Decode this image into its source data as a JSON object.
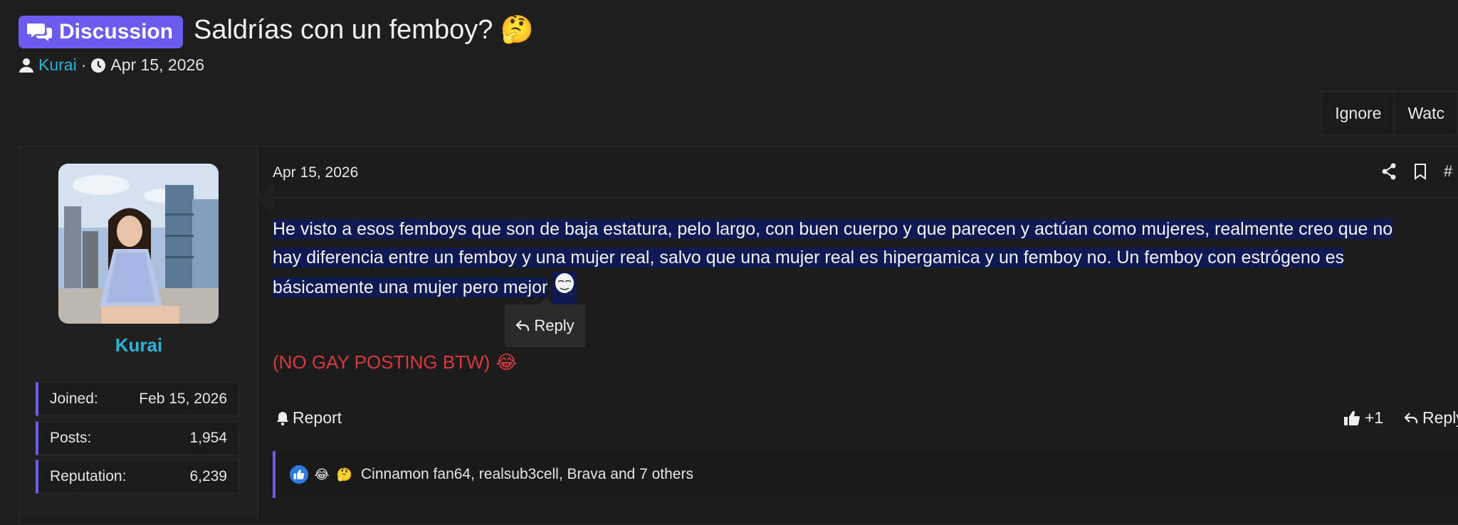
{
  "thread": {
    "prefix": "Discussion",
    "title": "Saldrías con un femboy?",
    "title_emoji": "🤔",
    "author": "Kurai",
    "byline_sep": "·",
    "date": "Apr 15, 2026"
  },
  "thread_actions": [
    "Ignore",
    "Watc"
  ],
  "user": {
    "name": "Kurai",
    "stats": [
      {
        "label": "Joined:",
        "value": "Feb 15, 2026"
      },
      {
        "label": "Posts:",
        "value": "1,954"
      },
      {
        "label": "Reputation:",
        "value": "6,239"
      }
    ]
  },
  "post": {
    "date": "Apr 15, 2026",
    "hash": "#",
    "body_lines": [
      "He visto a esos femboys que son de baja estatura, pelo largo, con buen cuerpo y que parecen y actúan como mujeres, realmente creo que no",
      "hay diferencia entre un femboy y una mujer real, salvo que una mujer real es hipergamica y un femboy no. Un femboy con estrógeno es",
      "básicamente una mujer pero mejor"
    ],
    "tooltip_reply": "Reply",
    "red_note": "(NO GAY POSTING BTW)",
    "red_emoji": "😂",
    "report_label": "Report",
    "like_label": "+1",
    "reply_label": "Reply",
    "reactions_text": "Cinnamon fan64, realsub3cell, Brava and 7 others",
    "reaction_icons": [
      "👍",
      "😂",
      "🤔"
    ]
  },
  "colors": {
    "accent": "#6b5cf0",
    "username": "#2bb5d4",
    "highlight": "#101a52",
    "red_text": "#d8393e"
  }
}
